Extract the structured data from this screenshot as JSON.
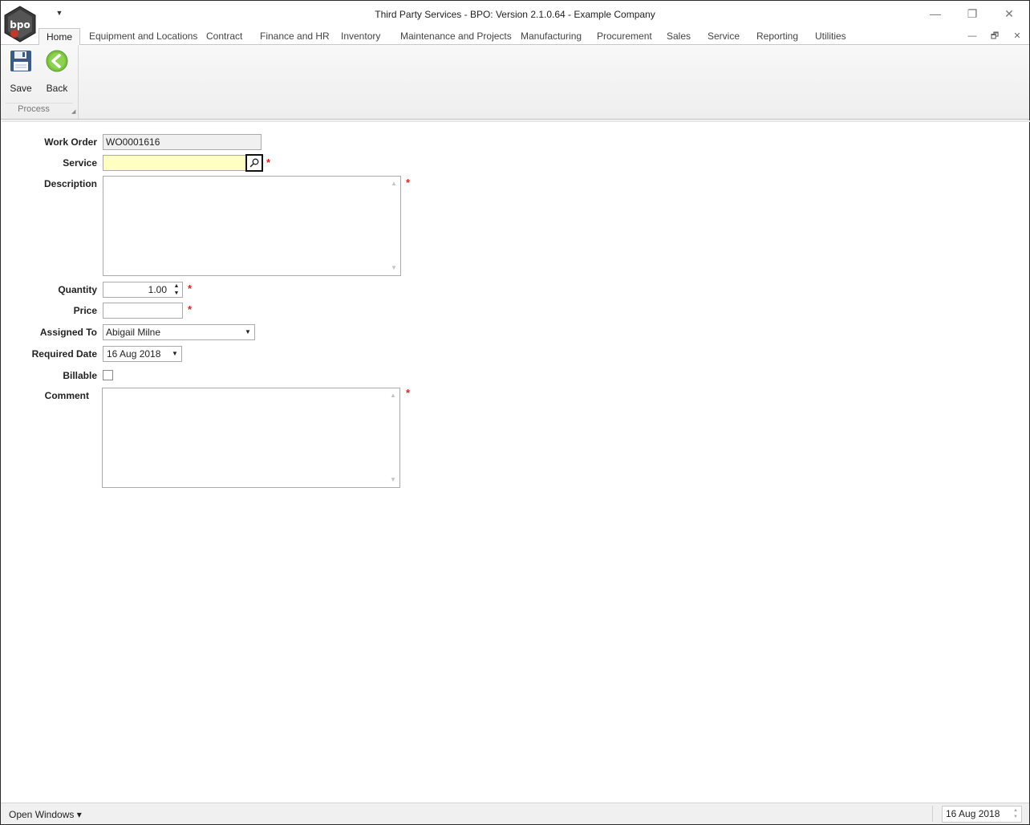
{
  "window": {
    "title": "Third Party Services - BPO: Version 2.1.0.64 - Example Company",
    "logo_text": "bpo",
    "qat_icon": "chevron-down-icon",
    "controls": {
      "minimize": "—",
      "restore": "❐",
      "close": "✕"
    }
  },
  "tabs": [
    {
      "label": "Home",
      "active": true
    },
    {
      "label": "Equipment and Locations"
    },
    {
      "label": "Contract"
    },
    {
      "label": "Finance and HR"
    },
    {
      "label": "Inventory"
    },
    {
      "label": "Maintenance and Projects"
    },
    {
      "label": "Manufacturing"
    },
    {
      "label": "Procurement"
    },
    {
      "label": "Sales"
    },
    {
      "label": "Service"
    },
    {
      "label": "Reporting"
    },
    {
      "label": "Utilities"
    }
  ],
  "mdi_controls": {
    "minimize": "—",
    "restore": "🗗",
    "close": "✕"
  },
  "ribbon": {
    "group_label": "Process",
    "save_label": "Save",
    "back_label": "Back"
  },
  "form": {
    "work_order_label": "Work Order",
    "work_order_value": "WO0001616",
    "service_label": "Service",
    "service_value": "",
    "description_label": "Description",
    "description_value": "",
    "quantity_label": "Quantity",
    "quantity_value": "1.00",
    "price_label": "Price",
    "price_value": "",
    "assigned_to_label": "Assigned To",
    "assigned_to_value": "Abigail Milne",
    "required_date_label": "Required Date",
    "required_date_value": "16 Aug 2018",
    "billable_label": "Billable",
    "billable_checked": false,
    "comment_label": "Comment",
    "comment_value": "",
    "required_marker": "*"
  },
  "statusbar": {
    "open_windows_label": "Open Windows ▾",
    "date_value": "16 Aug 2018"
  },
  "colors": {
    "required": "#e02020",
    "highlight_field": "#ffffc2",
    "back_icon": "#7cc242"
  }
}
